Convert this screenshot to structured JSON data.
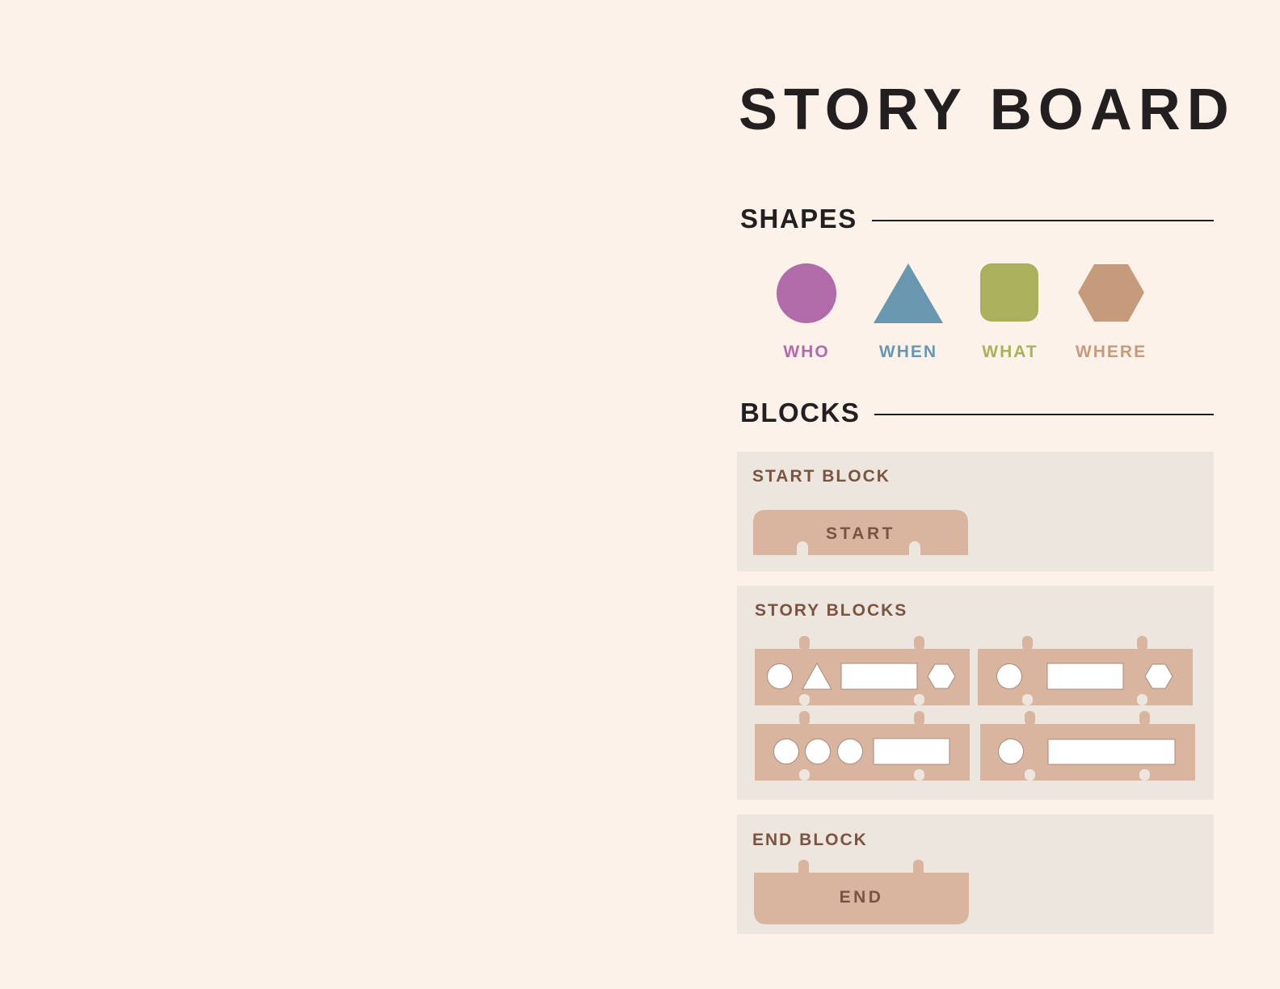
{
  "title": "STORY BOARD",
  "shapes_section": {
    "heading": "SHAPES",
    "items": [
      {
        "label": "WHO",
        "shape": "circle",
        "color": "#b06ba8"
      },
      {
        "label": "WHEN",
        "shape": "triangle",
        "color": "#6997af"
      },
      {
        "label": "WHAT",
        "shape": "rounded-square",
        "color": "#aab05c"
      },
      {
        "label": "WHERE",
        "shape": "hexagon",
        "color": "#c59b7c"
      }
    ]
  },
  "blocks_section": {
    "heading": "BLOCKS",
    "start_panel": {
      "title": "START BLOCK",
      "block_label": "START"
    },
    "story_panel": {
      "title": "STORY BLOCKS",
      "blocks": [
        {
          "slots": [
            "circle",
            "triangle",
            "rectangle",
            "hexagon"
          ]
        },
        {
          "slots": [
            "circle",
            "rectangle",
            "hexagon"
          ]
        },
        {
          "slots": [
            "circle",
            "circle",
            "circle",
            "rectangle"
          ]
        },
        {
          "slots": [
            "circle",
            "rectangle"
          ]
        }
      ]
    },
    "end_panel": {
      "title": "END BLOCK",
      "block_label": "END"
    }
  },
  "colors": {
    "background": "#fdf2e9",
    "panel": "#ede6de",
    "block": "#d9b49f",
    "panel_text": "#7a5440",
    "heading": "#231f20"
  }
}
